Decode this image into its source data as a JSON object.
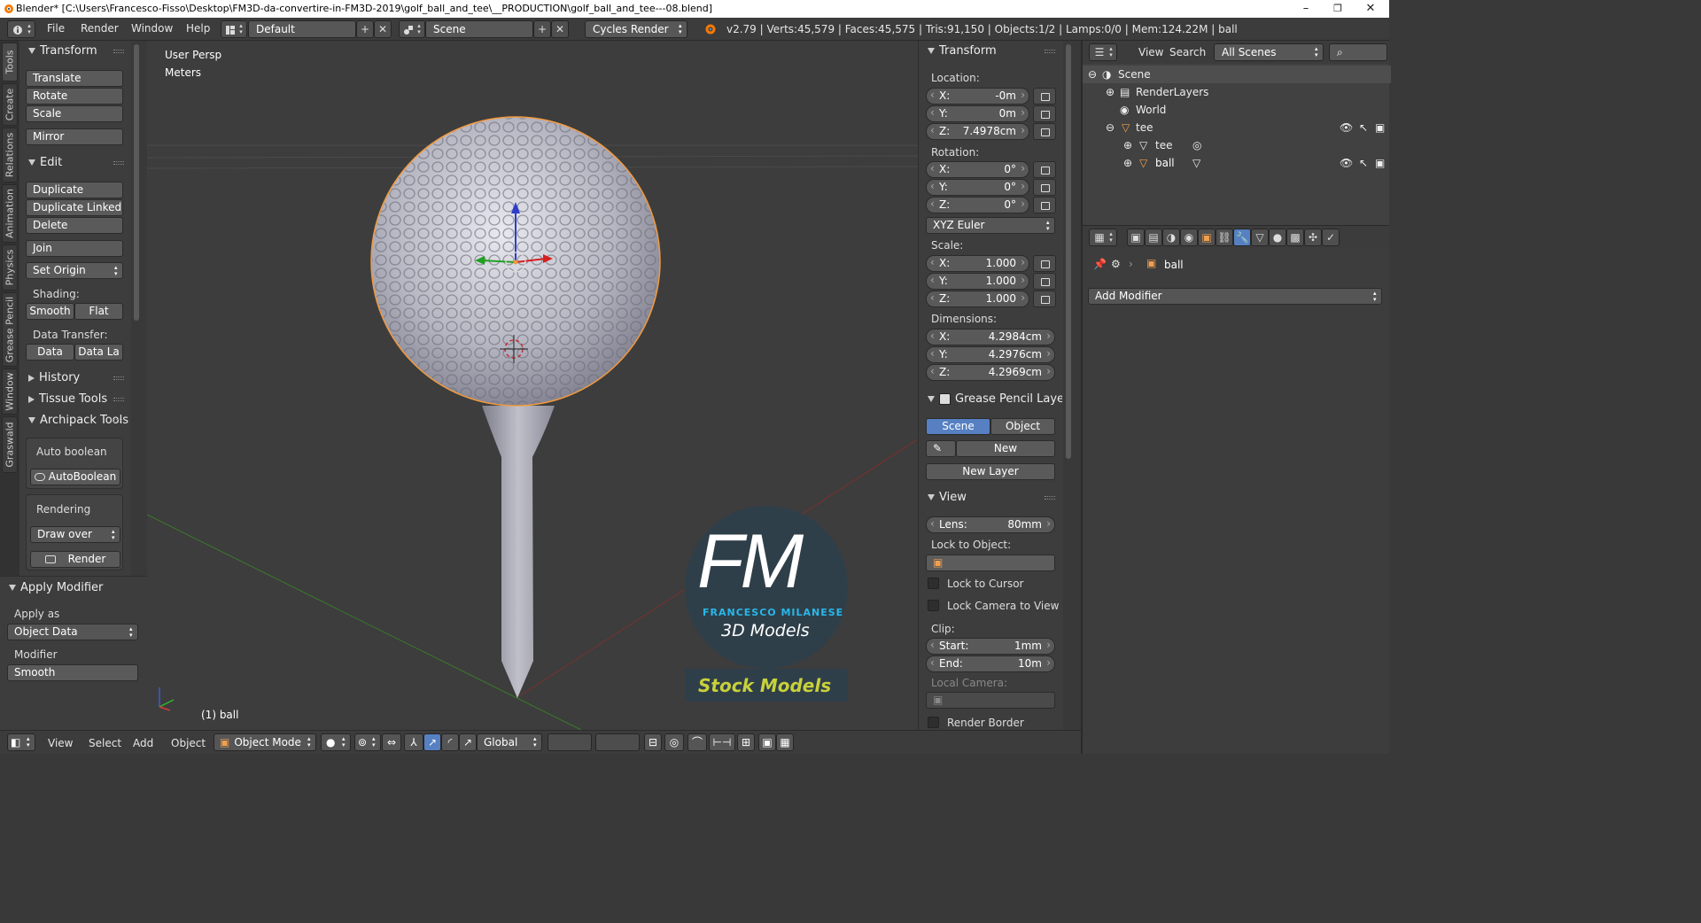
{
  "titlebar": {
    "title": "Blender* [C:\\Users\\Francesco-Fisso\\Desktop\\FM3D-da-convertire-in-FM3D-2019\\golf_ball_and_tee\\__PRODUCTION\\golf_ball_and_tee---08.blend]",
    "minimize": "–",
    "maximize": "❐",
    "close": "✕"
  },
  "infobar": {
    "menus": [
      "File",
      "Render",
      "Window",
      "Help"
    ],
    "layout": "Default",
    "scene": "Scene",
    "engine": "Cycles Render",
    "stats": "v2.79 | Verts:45,579 | Faces:45,575 | Tris:91,150 | Objects:1/2 | Lamps:0/0 | Mem:124.22M | ball",
    "add_glyph": "+",
    "x_glyph": "✕"
  },
  "tabs": [
    "Tools",
    "Create",
    "Relations",
    "Animation",
    "Physics",
    "Grease Pencil",
    "Window",
    "Graswald"
  ],
  "toolshelf": {
    "transform_title": "Transform",
    "translate": "Translate",
    "rotate": "Rotate",
    "scale": "Scale",
    "mirror": "Mirror",
    "edit_title": "Edit",
    "duplicate": "Duplicate",
    "duplicate_linked": "Duplicate Linked",
    "delete": "Delete",
    "join": "Join",
    "set_origin": "Set Origin",
    "shading_label": "Shading:",
    "smooth": "Smooth",
    "flat": "Flat",
    "data_transfer_label": "Data Transfer:",
    "data": "Data",
    "data_la": "Data La",
    "history_title": "History",
    "tissue_title": "Tissue Tools",
    "archipack_title": "Archipack Tools",
    "auto_boolean_label": "Auto boolean",
    "autoboolean_btn": "AutoBoolean",
    "rendering_label": "Rendering",
    "draw_over": "Draw over",
    "render_btn": "Render"
  },
  "operator": {
    "title": "Apply Modifier",
    "apply_as_label": "Apply as",
    "apply_as_value": "Object Data",
    "modifier_label": "Modifier",
    "modifier_value": "Smooth"
  },
  "viewport": {
    "view_name": "User Persp",
    "units": "Meters",
    "active_object": "(1) ball",
    "watermark_letters": "FM",
    "watermark_name": "FRANCESCO MILANESE",
    "watermark_sub": "3D Models",
    "watermark_banner": "Stock Models"
  },
  "npanel": {
    "transform_title": "Transform",
    "location_label": "Location:",
    "loc_x": "-0m",
    "loc_y": "0m",
    "loc_z": "7.4978cm",
    "rotation_label": "Rotation:",
    "rot_x": "0°",
    "rot_y": "0°",
    "rot_z": "0°",
    "rotation_mode": "XYZ Euler",
    "scale_label": "Scale:",
    "scale_x": "1.000",
    "scale_y": "1.000",
    "scale_z": "1.000",
    "dimensions_label": "Dimensions:",
    "dim_x": "4.2984cm",
    "dim_y": "4.2976cm",
    "dim_z": "4.2969cm",
    "axis_x": "X:",
    "axis_y": "Y:",
    "axis_z": "Z:",
    "gp_title": "Grease Pencil Layer",
    "gp_scene": "Scene",
    "gp_object": "Object",
    "gp_new": "New",
    "gp_new_layer": "New Layer",
    "view_title": "View",
    "lens_label": "Lens:",
    "lens_value": "80mm",
    "lock_to_object_label": "Lock to Object:",
    "lock_to_cursor": "Lock to Cursor",
    "lock_camera": "Lock Camera to View",
    "clip_label": "Clip:",
    "clip_start_label": "Start:",
    "clip_start": "1mm",
    "clip_end_label": "End:",
    "clip_end": "10m",
    "local_camera_label": "Local Camera:",
    "render_border": "Render Border"
  },
  "outliner": {
    "menu_view": "View",
    "menu_search": "Search",
    "filter": "All Scenes",
    "rows": [
      "Scene",
      "RenderLayers",
      "World",
      "tee",
      "tee",
      "ball"
    ]
  },
  "properties": {
    "object_name": "ball",
    "add_modifier": "Add Modifier"
  },
  "bottombar": {
    "menus": [
      "View",
      "Select",
      "Add",
      "Object"
    ],
    "mode": "Object Mode",
    "orientation": "Global"
  },
  "colors": {
    "accent_blue": "#5680c2",
    "selection_orange": "#f29a3e",
    "watermark_cyan": "#29b7e8",
    "banner_yellow": "#c8d13a"
  }
}
